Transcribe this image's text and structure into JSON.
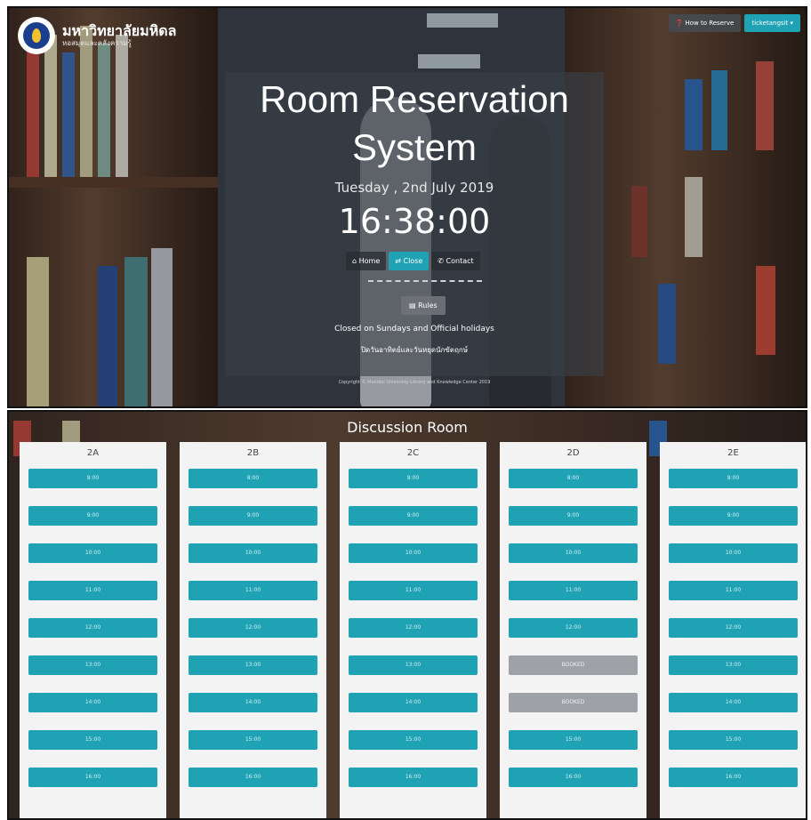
{
  "header": {
    "university_name": "มหาวิทยาลัยมหิดล",
    "university_sub": "หอสมุดและคลังความรู้",
    "how_to_reserve": "How to Reserve",
    "user_label": "ticketangsit"
  },
  "hero": {
    "title": "Room Reservation System",
    "date": "Tuesday , 2nd July 2019",
    "clock": "16:38:00",
    "nav": [
      "Home",
      "Close",
      "Contact"
    ],
    "rules_label": "Rules",
    "closed_note": "Closed on Sundays and Official holidays",
    "thai_note": "ปิดวันอาทิตย์และวันหยุดนักขัตฤกษ์",
    "copyright": "Copyright © Mahidol University Library and Knowledge Center 2019"
  },
  "discussion": {
    "title": "Discussion Room",
    "rooms": [
      {
        "name": "2A",
        "slots": [
          "8:00",
          "9:00",
          "10:00",
          "11:00",
          "12:00",
          "13:00",
          "14:00",
          "15:00",
          "16:00"
        ]
      },
      {
        "name": "2B",
        "slots": [
          "8:00",
          "9:00",
          "10:00",
          "11:00",
          "12:00",
          "13:00",
          "14:00",
          "15:00",
          "16:00"
        ]
      },
      {
        "name": "2C",
        "slots": [
          "8:00",
          "9:00",
          "10:00",
          "11:00",
          "12:00",
          "13:00",
          "14:00",
          "15:00",
          "16:00"
        ]
      },
      {
        "name": "2D",
        "slots": [
          "8:00",
          "9:00",
          "10:00",
          "11:00",
          "12:00",
          "BOOKED",
          "BOOKED",
          "15:00",
          "16:00"
        ]
      },
      {
        "name": "2E",
        "slots": [
          "8:00",
          "9:00",
          "10:00",
          "11:00",
          "12:00",
          "13:00",
          "14:00",
          "15:00",
          "16:00"
        ]
      }
    ]
  },
  "colors": {
    "accent": "#1ea2b4",
    "booked": "#9ea2a6"
  }
}
